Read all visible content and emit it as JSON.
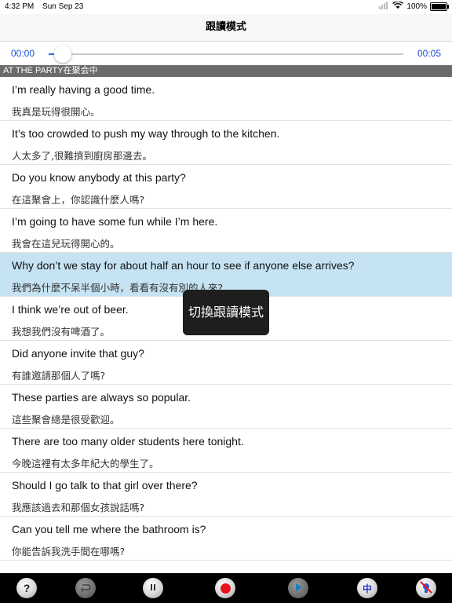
{
  "status_bar": {
    "time": "4:32 PM",
    "date": "Sun Sep 23",
    "battery": "100%"
  },
  "nav": {
    "title": "跟讀模式"
  },
  "player": {
    "current_time": "00:00",
    "total_time": "00:05",
    "progress": 0.04
  },
  "section": {
    "title": "AT THE PARTY在聚会中"
  },
  "sentences": [
    {
      "en": "I’m really having a good time.",
      "zh": "我真是玩得很開心。"
    },
    {
      "en": "It’s too crowded to push my way through to the kitchen.",
      "zh": "人太多了,很難擠到廚房那邊去。"
    },
    {
      "en": "Do you know anybody at this party?",
      "zh": "在這聚會上，你認識什麼人嗎?"
    },
    {
      "en": "I’m going to have some fun while I’m here.",
      "zh": "我會在這兒玩得開心的。"
    },
    {
      "en": "Why don’t we stay for about half an hour to see if anyone else arrives?",
      "zh": "我們為什麼不呆半個小時，看看有沒有別的人來?"
    },
    {
      "en": "I think we’re out of beer.",
      "zh": "我想我們沒有啤酒了。"
    },
    {
      "en": "Did anyone invite that guy?",
      "zh": "有誰邀請那個人了嗎?"
    },
    {
      "en": "These parties are always so popular.",
      "zh": "這些聚會總是很受歡迎。"
    },
    {
      "en": "There are too many older students here tonight.",
      "zh": "今晚這裡有太多年紀大的學生了。"
    },
    {
      "en": "Should I go talk to that girl over there?",
      "zh": "我應該過去和那個女孩說話嗎?"
    },
    {
      "en": "Can you tell me where the bathroom is?",
      "zh": "你能告訴我洗手間在哪嗎?"
    }
  ],
  "selected_index": 4,
  "toast": {
    "text": "切換跟讀模式"
  },
  "toolbar": {
    "help_label": "?",
    "chinese_label": "中",
    "record_color": "#e8141a",
    "play_color": "#1a7fc0",
    "chinese_color": "#2a3ad0"
  },
  "colors": {
    "accent": "#1a4fd0",
    "selected_row": "#c5e3f3",
    "section_header": "#6b6b6b"
  }
}
